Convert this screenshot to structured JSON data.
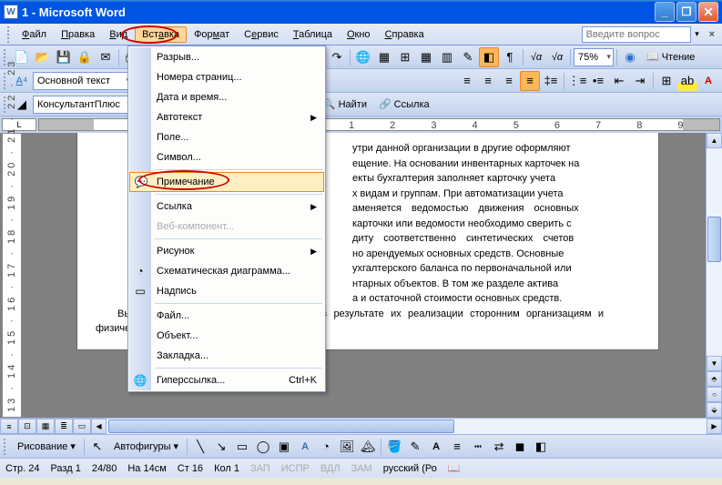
{
  "window": {
    "title": "1 - Microsoft Word"
  },
  "menubar": {
    "items": [
      "Файл",
      "Правка",
      "Вид",
      "Вставка",
      "Формат",
      "Сервис",
      "Таблица",
      "Окно",
      "Справка"
    ],
    "helpPlaceholder": "Введите вопрос"
  },
  "toolbar1": {
    "zoom": "75%",
    "readBtn": "Чтение"
  },
  "toolbar2": {
    "styleCombo": "Основной текст"
  },
  "toolbar3": {
    "konsultant": "КонсультантПлюс",
    "find": "Найти",
    "link": "Ссылка"
  },
  "dropdown": {
    "items": [
      {
        "label": "Разрыв...",
        "icon": ""
      },
      {
        "label": "Номера страниц...",
        "icon": ""
      },
      {
        "label": "Дата и время...",
        "icon": ""
      },
      {
        "label": "Автотекст",
        "icon": "",
        "sub": true
      },
      {
        "label": "Поле...",
        "icon": ""
      },
      {
        "label": "Символ...",
        "icon": ""
      },
      {
        "label": "Примечание",
        "icon": "💬",
        "hover": true,
        "circled": true
      },
      {
        "label": "Ссылка",
        "icon": "",
        "sub": true
      },
      {
        "label": "Веб-компонент...",
        "icon": "",
        "disabled": true
      },
      {
        "label": "Рисунок",
        "icon": "",
        "sub": true
      },
      {
        "label": "Схематическая диаграмма...",
        "icon": "◔"
      },
      {
        "label": "Надпись",
        "icon": "▭"
      },
      {
        "label": "Файл...",
        "icon": ""
      },
      {
        "label": "Объект...",
        "icon": ""
      },
      {
        "label": "Закладка...",
        "icon": ""
      },
      {
        "label": "Гиперссылка...",
        "icon": "🌐",
        "shortcut": "Ctrl+K"
      }
    ],
    "sepAfter": [
      5,
      6,
      8,
      11,
      14
    ]
  },
  "ruler": {
    "left": "L"
  },
  "document": {
    "p1": "утри данной организации в другие оформляют",
    "p2": "ещение. На основании инвентарных карточек на",
    "p3": "екты бухгалтерия заполняет карточку учета",
    "p4": "х видам и группам. При автоматизации учета",
    "p5": "аменяется ведомостью движения основных",
    "p6": "карточки или ведомости необходимо сверить с",
    "p7": "диту соответственно синтетических счетов",
    "p8": "но арендуемых основных средств. Основные",
    "p9": "ухгалтерского баланса по первоначальной или",
    "p10": "нтарных объектов. В том же разделе актива",
    "p11": "а и остаточной стоимости основных средств.",
    "p12": "Выбытие основных средств происходит в результате их реализации сторонним организациям и физическим лицам, а также при частичной"
  },
  "drawbar": {
    "draw": "Рисование",
    "autoshapes": "Автофигуры"
  },
  "status": {
    "page": "Стр. 24",
    "section": "Разд 1",
    "pages": "24/80",
    "at": "На 14см",
    "line": "Ст 16",
    "col": "Кол 1",
    "rec": "ЗАП",
    "trk": "ИСПР",
    "ext": "ВДЛ",
    "ovr": "ЗАМ",
    "lang": "русский (Ро"
  }
}
